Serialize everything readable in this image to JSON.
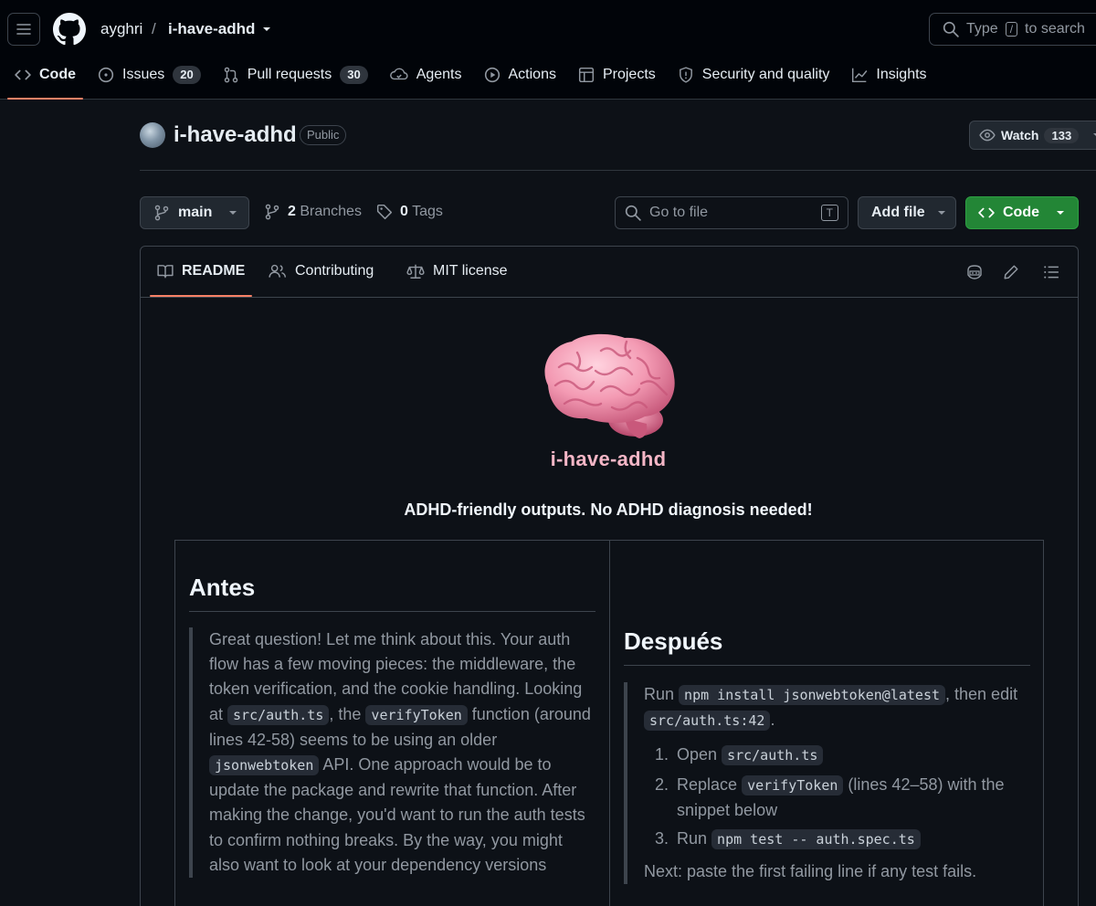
{
  "header": {
    "owner": "ayghri",
    "separator": "/",
    "repo": "i-have-adhd",
    "search_prefix": "Type",
    "search_key": "/",
    "search_suffix": "to search"
  },
  "tabs": [
    {
      "label": "Code",
      "icon": "code-icon"
    },
    {
      "label": "Issues",
      "count": "20",
      "icon": "issue-opened-icon"
    },
    {
      "label": "Pull requests",
      "count": "30",
      "icon": "git-pull-request-icon"
    },
    {
      "label": "Agents",
      "icon": "agent-icon"
    },
    {
      "label": "Actions",
      "icon": "play-icon"
    },
    {
      "label": "Projects",
      "icon": "table-icon"
    },
    {
      "label": "Security and quality",
      "icon": "shield-icon"
    },
    {
      "label": "Insights",
      "icon": "graph-icon"
    }
  ],
  "repo": {
    "name": "i-have-adhd",
    "visibility": "Public",
    "watch_label": "Watch",
    "watch_count": "133"
  },
  "branch_bar": {
    "branch": "main",
    "branches_count": "2",
    "branches_label": "Branches",
    "tags_count": "0",
    "tags_label": "Tags",
    "goto_placeholder": "Go to file",
    "goto_key": "T",
    "add_file": "Add file",
    "code_button": "Code"
  },
  "readme_tabs": {
    "readme": "README",
    "contributing": "Contributing",
    "license": "MIT license"
  },
  "readme": {
    "logo_text": "i-have-adhd",
    "tagline": "ADHD-friendly outputs. No ADHD diagnosis needed!",
    "before": {
      "heading": "Antes",
      "t1": "Great question! Let me think about this. Your auth flow has a few moving pieces: the middleware, the token verification, and the cookie handling. Looking at",
      "c1": "src/auth.ts",
      "t2": ", the",
      "c2": "verifyToken",
      "t3": "function (around lines 42-58) seems to be using an older",
      "c3": "jsonwebtoken",
      "t4": "API. One approach would be to update the package and rewrite that function. After making the change, you'd want to run the auth tests to confirm nothing breaks. By the way, you might also want to look at your dependency versions"
    },
    "after": {
      "heading": "Después",
      "run": "Run",
      "install_cmd": "npm install jsonwebtoken@latest",
      "then_edit": ", then edit",
      "edit_target": "src/auth.ts:42",
      "period": ".",
      "steps": [
        {
          "num": "1.",
          "pre": "Open",
          "code": "src/auth.ts",
          "post": ""
        },
        {
          "num": "2.",
          "pre": "Replace",
          "code": "verifyToken",
          "post": "(lines 42–58) with the snippet below"
        },
        {
          "num": "3.",
          "pre": "Run",
          "code": "npm test -- auth.spec.ts",
          "post": ""
        }
      ],
      "next": "Next: paste the first failing line if any test fails."
    }
  },
  "colors": {
    "background": "#0d1117",
    "header_bg": "#010409",
    "accent_underline": "#f78166",
    "primary_button": "#238636",
    "logo_pink": "#f4b6c6"
  }
}
